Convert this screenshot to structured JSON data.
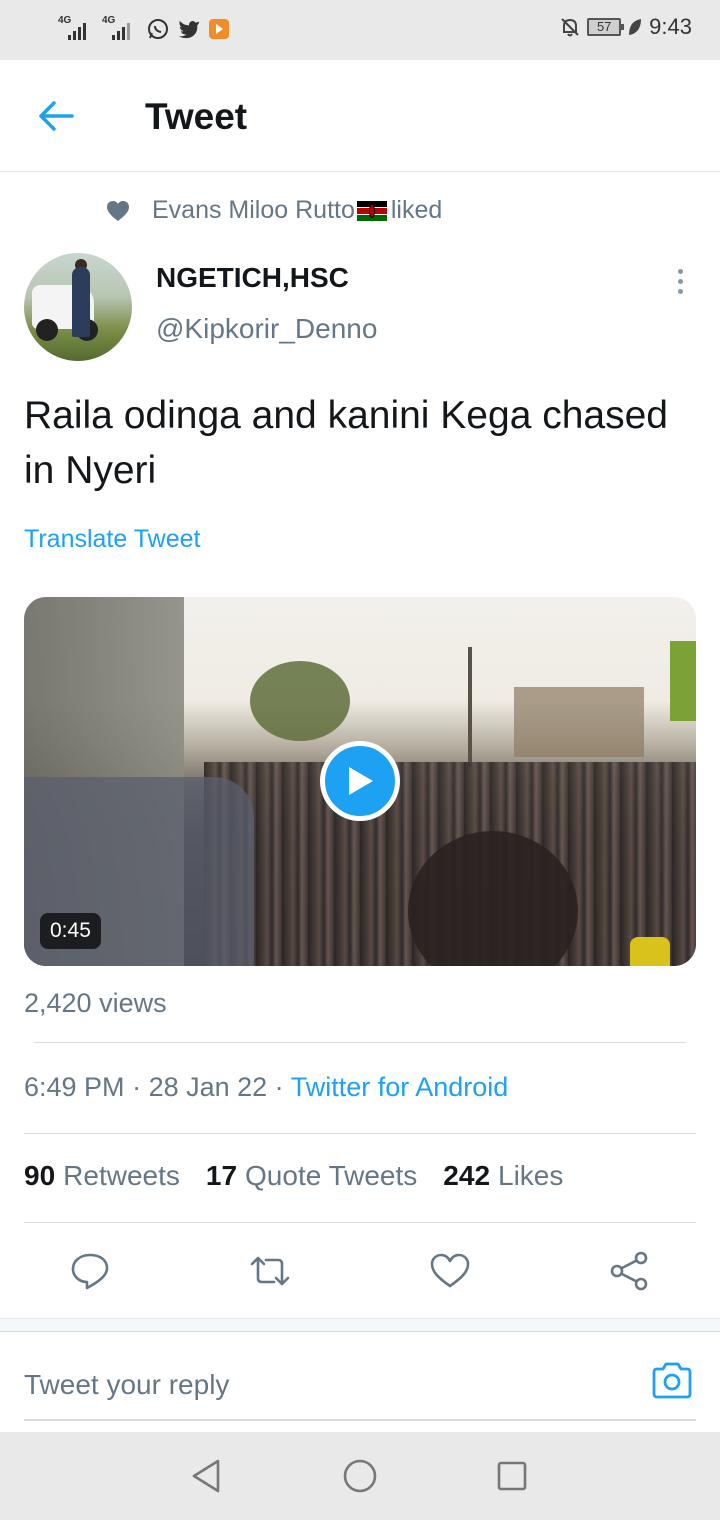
{
  "status_bar": {
    "network_1": "4G",
    "network_2": "4G",
    "battery": "57",
    "time": "9:43",
    "icons": [
      "signal-icon",
      "signal-icon",
      "whatsapp-icon",
      "twitter-icon",
      "app-notification-icon",
      "mute-icon",
      "battery-icon",
      "leaf-icon"
    ]
  },
  "header": {
    "title": "Tweet",
    "back_icon": "arrow-left-icon"
  },
  "social_context": {
    "name": "Evans Miloo Rutto",
    "action": "liked",
    "flag": "kenya-flag"
  },
  "tweet": {
    "author_name": "NGETICH,HSC",
    "author_handle": "@Kipkorir_Denno",
    "text": "Raila odinga and kanini Kega chased in Nyeri",
    "translate_label": "Translate Tweet",
    "video_duration": "0:45",
    "views": "2,420 views",
    "time": "6:49 PM",
    "date": "28 Jan 22",
    "source": "Twitter for Android",
    "sep": " · "
  },
  "stats": {
    "retweets_count": "90",
    "retweets_label": "Retweets",
    "quotes_count": "17",
    "quotes_label": "Quote Tweets",
    "likes_count": "242",
    "likes_label": "Likes"
  },
  "actions": [
    "reply-icon",
    "retweet-icon",
    "like-icon",
    "share-icon"
  ],
  "reply": {
    "placeholder": "Tweet your reply"
  },
  "colors": {
    "accent": "#1da1f2",
    "text": "#14171a",
    "muted": "#657786"
  }
}
